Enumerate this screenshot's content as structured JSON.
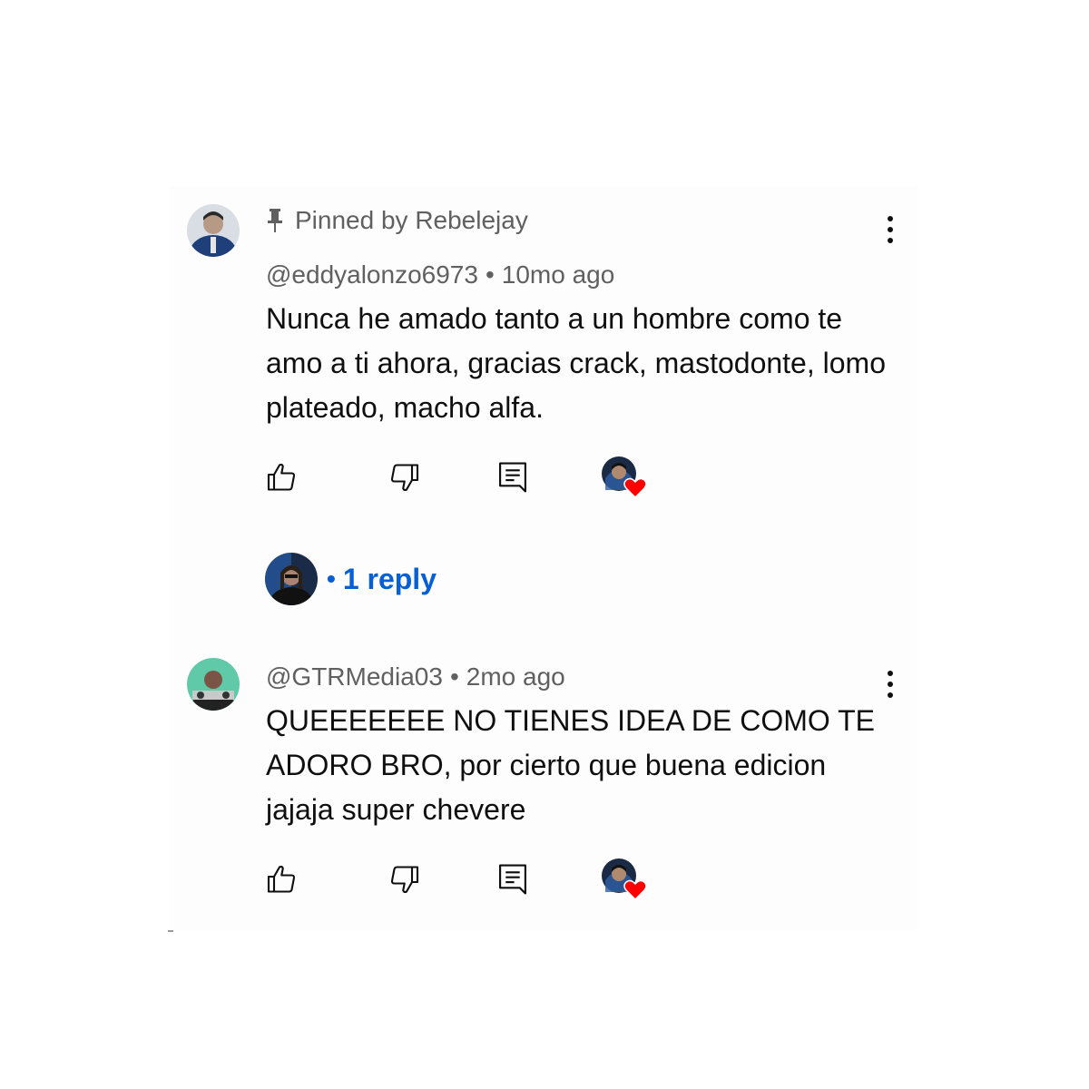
{
  "comments": [
    {
      "pinned_label": "Pinned by Rebelejay",
      "author": "@eddyalonzo6973",
      "separator": "•",
      "time": "10mo ago",
      "text": "Nunca he amado tanto a un hombre como te amo a ti ahora, gracias crack, mastodonte, lomo plateado, macho alfa.",
      "avatar_color": "#2b4a7e",
      "replies_label": "1 reply",
      "reply_prefix": "•"
    },
    {
      "author": "@GTRMedia03",
      "separator": "•",
      "time": "2mo ago",
      "text": "QUEEEEEEE NO TIENES IDEA DE COMO TE ADORO BRO, por cierto que buena edicion jajaja super chevere",
      "avatar_color": "#5fc9a8"
    }
  ],
  "icons": {
    "pin": "pin-icon",
    "like": "thumbs-up-icon",
    "dislike": "thumbs-down-icon",
    "reply": "reply-comment-icon",
    "more": "more-vertical-icon",
    "heart": "creator-heart-icon"
  },
  "colors": {
    "link_blue": "#065fd4",
    "meta_gray": "#606060",
    "heart_red": "#ff0000"
  }
}
